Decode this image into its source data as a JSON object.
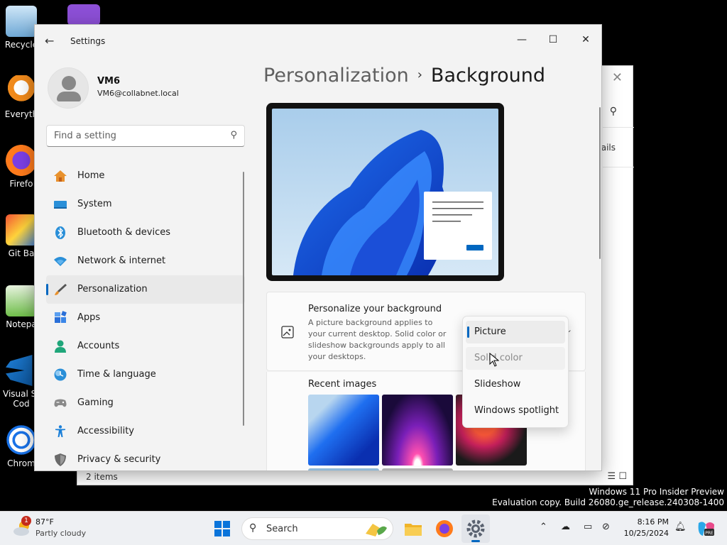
{
  "desktop": {
    "icons": [
      {
        "label": "Recycle"
      },
      {
        "label": "Everyth"
      },
      {
        "label": "Firefo"
      },
      {
        "label": "Git Ba"
      },
      {
        "label": "Notepa"
      },
      {
        "label": "Visual St\nCod"
      },
      {
        "label": "Chrom"
      }
    ]
  },
  "explorer": {
    "details_label": "ails",
    "status_text": "2 items"
  },
  "settings": {
    "title": "Settings",
    "user": {
      "name": "VM6",
      "email": "VM6@collabnet.local"
    },
    "search": {
      "placeholder": "Find a setting"
    },
    "nav": [
      {
        "label": "Home",
        "icon": "home-icon",
        "color": "#e8912d"
      },
      {
        "label": "System",
        "icon": "system-icon",
        "color": "#2a8fd8"
      },
      {
        "label": "Bluetooth & devices",
        "icon": "bluetooth-icon",
        "color": "#2a8fd8"
      },
      {
        "label": "Network & internet",
        "icon": "wifi-icon",
        "color": "#2a8fd8"
      },
      {
        "label": "Personalization",
        "icon": "brush-icon",
        "color": "#d98a3a",
        "selected": true
      },
      {
        "label": "Apps",
        "icon": "apps-icon",
        "color": "#2a6fd8"
      },
      {
        "label": "Accounts",
        "icon": "accounts-icon",
        "color": "#1fa67a"
      },
      {
        "label": "Time & language",
        "icon": "globe-clock-icon",
        "color": "#2a8fd8"
      },
      {
        "label": "Gaming",
        "icon": "gamepad-icon",
        "color": "#777777"
      },
      {
        "label": "Accessibility",
        "icon": "accessibility-icon",
        "color": "#1a7fd8"
      },
      {
        "label": "Privacy & security",
        "icon": "shield-icon",
        "color": "#6a6a6a"
      }
    ],
    "breadcrumb": {
      "parent": "Personalization",
      "separator": "›",
      "current": "Background"
    },
    "background_card": {
      "title": "Personalize your background",
      "description": "A picture background applies to your current desktop. Solid color or slideshow backgrounds apply to all your desktops."
    },
    "recent_images_label": "Recent images",
    "dropdown": {
      "options": [
        "Picture",
        "Solid color",
        "Slideshow",
        "Windows spotlight"
      ],
      "selected": "Picture"
    }
  },
  "watermark": {
    "line1": "Windows 11 Pro Insider Preview",
    "line2": "Evaluation copy. Build 26080.ge_release.240308-1400"
  },
  "taskbar": {
    "weather": {
      "temp": "87°F",
      "desc": "Partly cloudy",
      "badge": "1"
    },
    "search_label": "Search",
    "clock": {
      "time": "8:16 PM",
      "date": "10/25/2024"
    }
  },
  "colors": {
    "accent": "#0067c0"
  }
}
